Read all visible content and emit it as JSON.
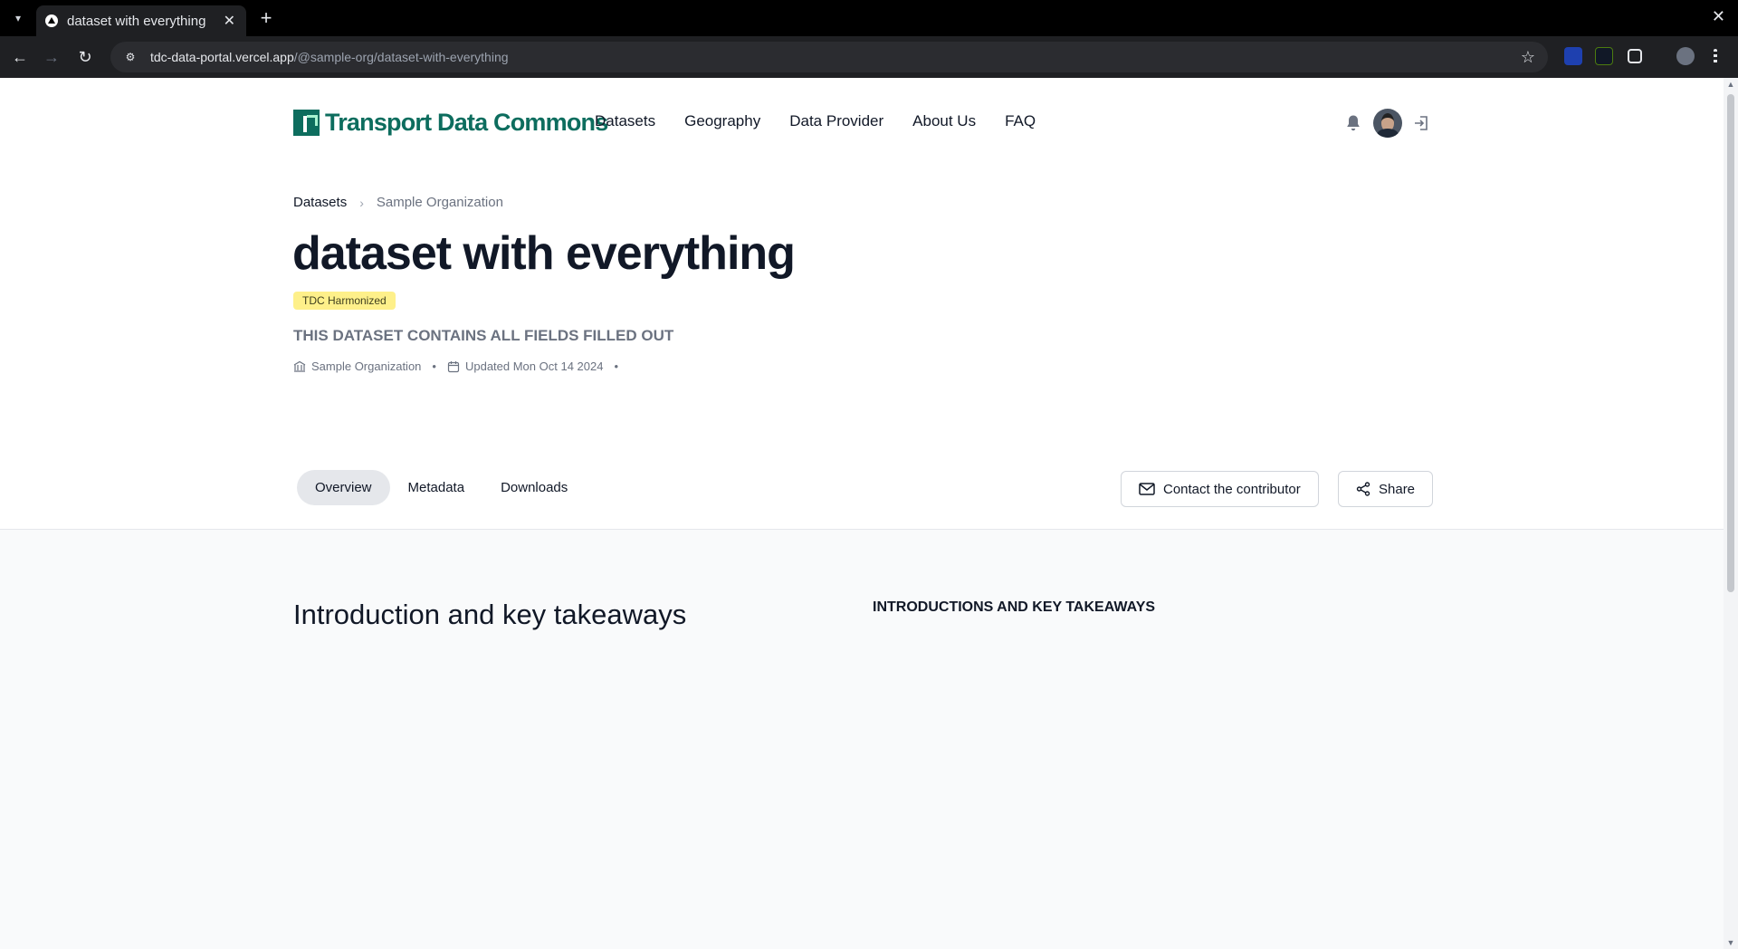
{
  "browser": {
    "tab_title": "dataset with everything",
    "url_host": "tdc-data-portal.vercel.app",
    "url_path": "/@sample-org/dataset-with-everything"
  },
  "header": {
    "logo_text": "Transport Data Commons",
    "nav": [
      "Datasets",
      "Geography",
      "Data Provider",
      "About Us",
      "FAQ"
    ]
  },
  "breadcrumb": {
    "root": "Datasets",
    "current": "Sample Organization"
  },
  "dataset": {
    "title": "dataset with everything",
    "badge": "TDC Harmonized",
    "subtitle": "THIS DATASET CONTAINS ALL FIELDS FILLED OUT",
    "organization": "Sample Organization",
    "updated": "Updated Mon Oct 14 2024"
  },
  "tabs": [
    "Overview",
    "Metadata",
    "Downloads"
  ],
  "actions": {
    "contact": "Contact the contributor",
    "share": "Share"
  },
  "overview": {
    "heading": "Introduction and key takeaways",
    "side_heading": "INTRODUCTIONS AND KEY TAKEAWAYS"
  },
  "colors": {
    "brand": "#0d6d5e",
    "badge_bg": "#fef08a"
  }
}
